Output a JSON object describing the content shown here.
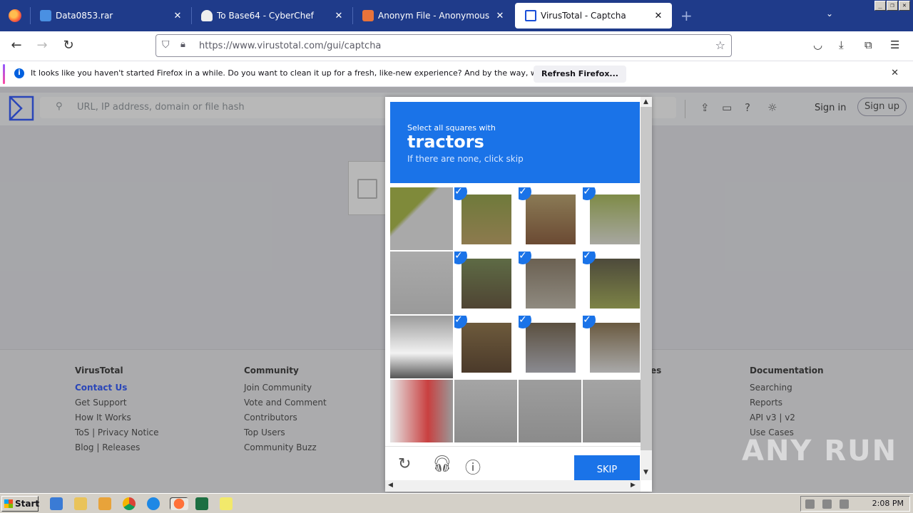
{
  "browser": {
    "tabs": [
      {
        "label": "Data0853.rar",
        "icon": "link-icon"
      },
      {
        "label": "To Base64 - CyberChef",
        "icon": "chef-hat-icon"
      },
      {
        "label": "Anonym File - Anonymous File Uplo",
        "icon": "anonym-file-icon"
      },
      {
        "label": "VirusTotal - Captcha",
        "icon": "virustotal-icon",
        "active": true
      }
    ],
    "new_tab": "+",
    "url": "https://www.virustotal.com/gui/captcha"
  },
  "notification": {
    "message": "It looks like you haven't started Firefox in a while. Do you want to clean it up for a fresh, like-new experience? And by the way, welcome back!",
    "button": "Refresh Firefox..."
  },
  "vt": {
    "search_placeholder": "URL, IP address, domain or file hash",
    "sign_in": "Sign in",
    "sign_up": "Sign up"
  },
  "captcha": {
    "instruction": "Select all squares with",
    "target": "tractors",
    "hint": "If there are none, click skip",
    "skip_label": "SKIP",
    "selected_tiles": [
      1,
      2,
      3,
      5,
      6,
      7,
      9,
      10,
      11
    ]
  },
  "footer": {
    "columns": [
      {
        "title": "VirusTotal",
        "items": [
          "Contact Us",
          "Get Support",
          "How It Works",
          "ToS | Privacy Notice",
          "Blog | Releases"
        ]
      },
      {
        "title": "Community",
        "items": [
          "Join Community",
          "Vote and Comment",
          "Contributors",
          "Top Users",
          "Community Buzz"
        ]
      },
      {
        "title": "es",
        "items": []
      },
      {
        "title": "Documentation",
        "items": [
          "Searching",
          "Reports",
          "API v3 | v2",
          "Use Cases"
        ]
      }
    ]
  },
  "watermark": "ANY RUN",
  "taskbar": {
    "start": "Start",
    "time": "2:08 PM"
  },
  "colors": {
    "captcha_blue": "#1a73e8",
    "tabstrip": "#1f3b8a",
    "link": "#3b61ff"
  }
}
